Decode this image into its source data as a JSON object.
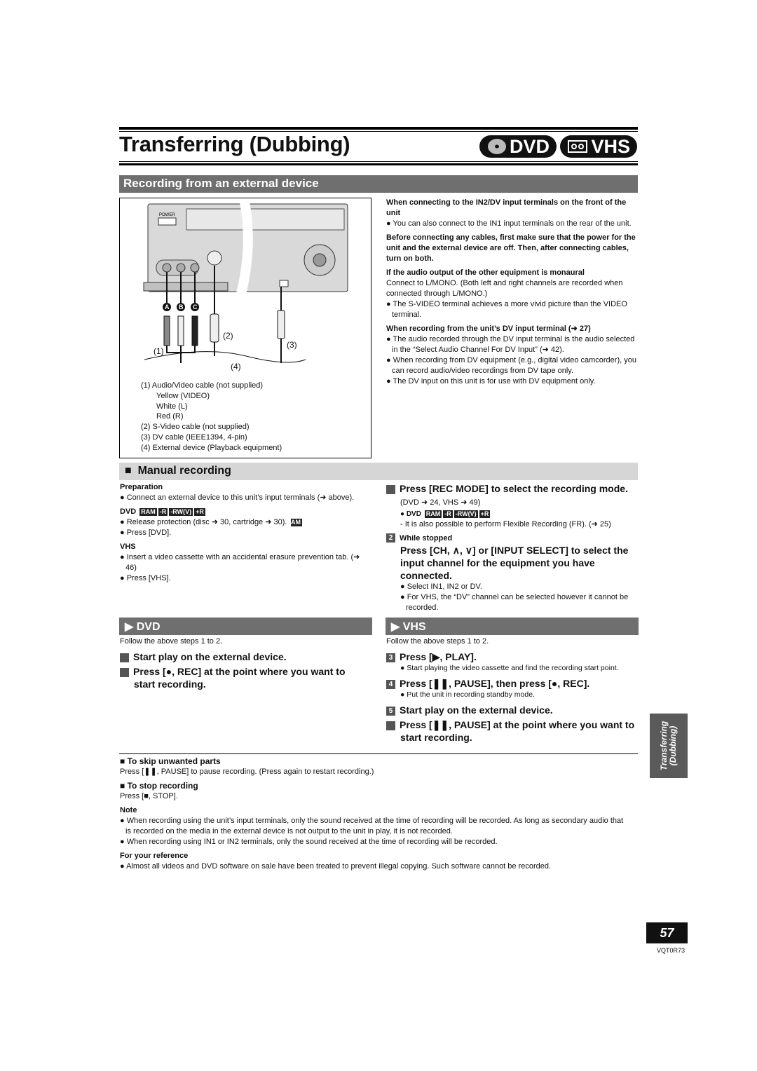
{
  "header": {
    "title": "Transferring (Dubbing)",
    "badge_dvd": "DVD",
    "badge_vhs": "VHS",
    "icons": [
      "dvd-disc-icon",
      "vhs-cassette-icon"
    ]
  },
  "section1": {
    "title": "Recording from an external device",
    "figure": {
      "labels": {
        "a": "A",
        "b": "B",
        "c": "C",
        "n1": "(1)",
        "n2": "(2)",
        "n3": "(3)",
        "n4": "(4)",
        "power": "POWER"
      },
      "legend": [
        "(1)  Audio/Video cable (not supplied)",
        "Yellow (VIDEO)",
        "White (L)",
        "Red (R)",
        "(2)  S-Video cable (not supplied)",
        "(3)  DV cable (IEEE1394, 4-pin)",
        "(4)  External device (Playback equipment)"
      ]
    },
    "notes": [
      {
        "head": "When connecting to the IN2/DV input terminals on the front of the unit",
        "items": [
          "You can also connect to the IN1 input terminals on the rear of the unit."
        ]
      },
      {
        "head": "Before connecting any cables, first make sure that the power for the unit and the external device are off. Then, after connecting cables, turn on both.",
        "items": []
      },
      {
        "head": "If the audio output of the other equipment is monaural",
        "text": "Connect to L/MONO. (Both left and right channels are recorded when connected through L/MONO.)",
        "items": [
          "The S-VIDEO terminal achieves a more vivid picture than the VIDEO terminal."
        ]
      },
      {
        "head": "When recording from the unit’s DV input terminal (➜ 27)",
        "items": [
          "The audio recorded through the DV input terminal is the audio selected in the “Select Audio Channel For DV Input” (➜ 42).",
          "When recording from DV equipment (e.g., digital video camcorder), you can record audio/video recordings from DV tape only.",
          "The DV input on this unit is for use with DV equipment only."
        ]
      }
    ]
  },
  "manual": {
    "title": "Manual recording",
    "prep_head": "Preparation",
    "prep_items": [
      "Connect an external device to this unit’s input terminals (➜ above)."
    ],
    "dvd_label": "DVD",
    "tags": [
      "RAM",
      "-R",
      "-RW(V)",
      "+R"
    ],
    "dvd_items": [
      "Release protection (disc ➜ 30, cartridge ➜ 30).",
      "Press [DVD]."
    ],
    "vhs_label": "VHS",
    "vhs_items": [
      "Insert a video cassette with an accidental erasure prevention tab. (➜ 46)",
      "Press [VHS]."
    ],
    "step1": {
      "num": "1",
      "bold": "Press [REC MODE] to select the recording mode.",
      "ref": "(DVD ➜ 24, VHS ➜ 49)",
      "sub_label": "DVD",
      "note": "- It is also possible to perform Flexible Recording (FR). (➜ 25)"
    },
    "step2": {
      "num": "2",
      "pre": "While stopped",
      "bold": "Press [CH, ∧, ∨] or [INPUT SELECT] to select the input channel for the equipment you have connected.",
      "items": [
        "Select IN1, IN2 or DV.",
        "For VHS, the “DV” channel can be selected however it cannot be recorded."
      ]
    }
  },
  "dvd": {
    "title": "DVD",
    "intro": "Follow the above steps 1 to 2.",
    "steps": [
      {
        "num": "3",
        "text": "Start play on the external device."
      },
      {
        "num": "4",
        "text": "Press [●, REC] at the point where you want to start recording."
      }
    ]
  },
  "vhs": {
    "title": "VHS",
    "intro": "Follow the above steps 1 to 2.",
    "steps": [
      {
        "num": "3",
        "text": "Press [▶, PLAY].",
        "note": "Start playing the video cassette and find the recording start point."
      },
      {
        "num": "4",
        "text": "Press [❚❚, PAUSE], then press [●, REC].",
        "note": "Put the unit in recording standby mode."
      },
      {
        "num": "5",
        "text": "Start play on the external device."
      },
      {
        "num": "6",
        "text": "Press [❚❚, PAUSE] at the point where you want to start recording."
      }
    ]
  },
  "footer": {
    "skip_head": "To skip unwanted parts",
    "skip_text": "Press [❚❚, PAUSE] to pause recording. (Press again to restart recording.)",
    "stop_head": "To stop recording",
    "stop_text": "Press [■, STOP].",
    "note_head": "Note",
    "note_items": [
      "When recording using the unit’s input terminals, only the sound received at the time of recording will be recorded. As long as secondary audio that is recorded on the media in the external device is not output to the unit in play, it is not recorded.",
      "When recording using IN1 or IN2 terminals, only the sound received at the time of recording will be recorded."
    ],
    "ref_head": "For your reference",
    "ref_items": [
      "Almost all videos and DVD software on sale have been treated to prevent illegal copying. Such software cannot be recorded."
    ]
  },
  "side_tab": {
    "line1": "Transferring",
    "line2": "(Dubbing)"
  },
  "page_number": "57",
  "doc_code": "VQT0R73"
}
